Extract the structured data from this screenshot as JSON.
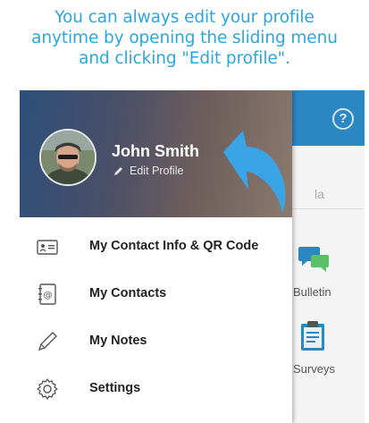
{
  "caption": {
    "line1": "You can always edit your profile",
    "line2": "anytime by opening the sliding menu",
    "line3": "and clicking \"Edit profile\"."
  },
  "background_app": {
    "help_icon_glyph": "?",
    "search_fragment": "la",
    "tiles": [
      {
        "label": "Bulletin",
        "icon": "chat-bubbles-icon"
      },
      {
        "label": "Surveys",
        "icon": "clipboard-icon"
      }
    ]
  },
  "drawer": {
    "user_name": "John Smith",
    "edit_profile_label": "Edit Profile",
    "menu_items": [
      {
        "label": "My Contact Info & QR Code",
        "icon": "contact-card-icon"
      },
      {
        "label": "My Contacts",
        "icon": "address-book-icon"
      },
      {
        "label": "My Notes",
        "icon": "pencil-icon"
      },
      {
        "label": "Settings",
        "icon": "gear-icon"
      }
    ]
  },
  "colors": {
    "caption": "#2ba6de",
    "app_bar": "#2b87c2",
    "arrow": "#3aa5e6"
  }
}
